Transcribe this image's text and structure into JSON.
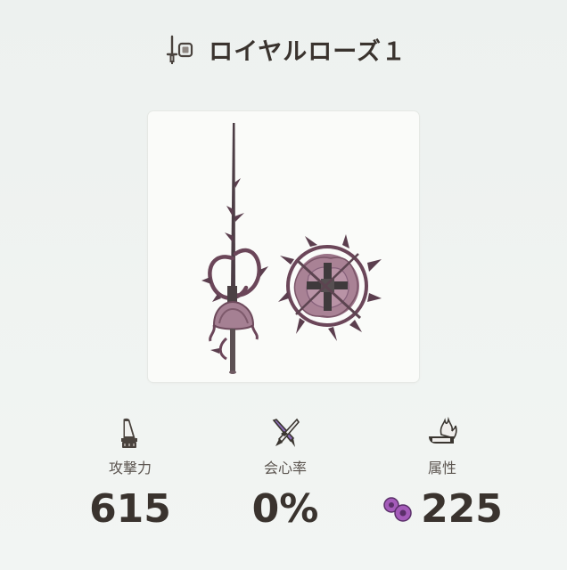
{
  "weapon": {
    "name": "ロイヤルローズ１",
    "type_icon": "sword-and-shield-icon",
    "image": "royal-rose-sword-and-shield-image"
  },
  "stats": {
    "attack": {
      "label": "攻撃力",
      "value": "615",
      "icon": "attack-blade-icon"
    },
    "affinity": {
      "label": "会心率",
      "value": "0%",
      "icon": "affinity-crossed-blades-icon"
    },
    "element": {
      "label": "属性",
      "value": "225",
      "icon": "element-flame-blade-icon",
      "element_type_icon": "poison-bubbles-icon",
      "element_color": "#9a4fb0"
    }
  },
  "colors": {
    "background": "#eef2f0",
    "text": "#3a332e",
    "label": "#5b544f",
    "weapon_accent": "#7a4a63"
  }
}
